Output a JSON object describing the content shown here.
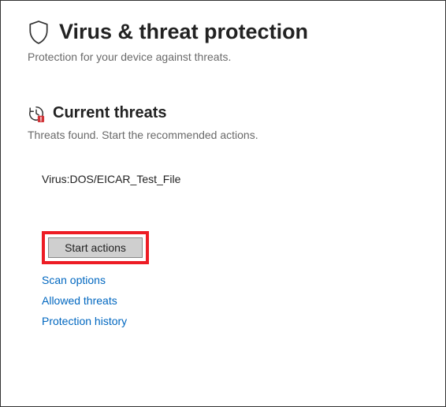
{
  "header": {
    "title": "Virus & threat protection",
    "subtitle": "Protection for your device against threats."
  },
  "section": {
    "title": "Current threats",
    "subtitle": "Threats found. Start the recommended actions."
  },
  "threat": {
    "name": "Virus:DOS/EICAR_Test_File"
  },
  "actions": {
    "start_label": "Start actions"
  },
  "links": {
    "scan_options": "Scan options",
    "allowed_threats": "Allowed threats",
    "protection_history": "Protection history"
  },
  "colors": {
    "highlight": "#ed1c24",
    "link": "#0067c0"
  }
}
